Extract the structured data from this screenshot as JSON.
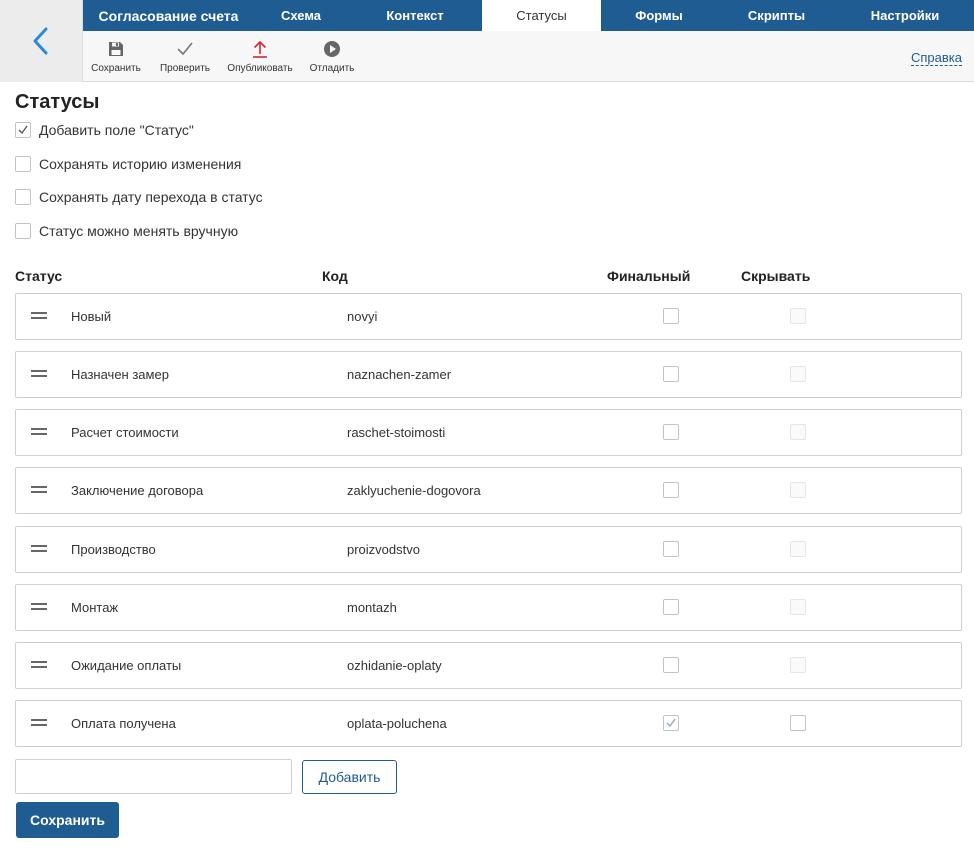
{
  "tabs": {
    "title": "Согласование счета",
    "items": [
      {
        "label": "Схема"
      },
      {
        "label": "Контекст"
      },
      {
        "label": "Статусы"
      },
      {
        "label": "Формы"
      },
      {
        "label": "Скрипты"
      },
      {
        "label": "Настройки"
      }
    ]
  },
  "toolbar": {
    "save": "Сохранить",
    "check": "Проверить",
    "publish": "Опубликовать",
    "debug": "Отладить",
    "help": "Справка"
  },
  "page": {
    "title": "Статусы",
    "options": [
      {
        "label": "Добавить поле \"Статус\"",
        "checked": true
      },
      {
        "label": "Сохранять историю изменения",
        "checked": false
      },
      {
        "label": "Сохранять дату перехода в статус",
        "checked": false
      },
      {
        "label": "Статус можно менять вручную",
        "checked": false
      }
    ]
  },
  "table": {
    "headers": {
      "status": "Статус",
      "code": "Код",
      "final": "Финальный",
      "hide": "Скрывать"
    },
    "rows": [
      {
        "name": "Новый",
        "code": "novyi",
        "final": false,
        "hide": false
      },
      {
        "name": "Назначен замер",
        "code": "naznachen-zamer",
        "final": false,
        "hide": false
      },
      {
        "name": "Расчет стоимости",
        "code": "raschet-stoimosti",
        "final": false,
        "hide": false
      },
      {
        "name": "Заключение договора",
        "code": "zaklyuchenie-dogovora",
        "final": false,
        "hide": false
      },
      {
        "name": "Производство",
        "code": "proizvodstvo",
        "final": false,
        "hide": false
      },
      {
        "name": "Монтаж",
        "code": "montazh",
        "final": false,
        "hide": false
      },
      {
        "name": "Ожидание оплаты",
        "code": "ozhidanie-oplaty",
        "final": false,
        "hide": false
      },
      {
        "name": "Оплата получена",
        "code": "oplata-poluchena",
        "final": true,
        "hide": false
      }
    ]
  },
  "footer": {
    "new_status_value": "",
    "add_label": "Добавить",
    "save_label": "Сохранить"
  },
  "colors": {
    "brand": "#1f5c91",
    "publish_icon": "#d9262e"
  }
}
